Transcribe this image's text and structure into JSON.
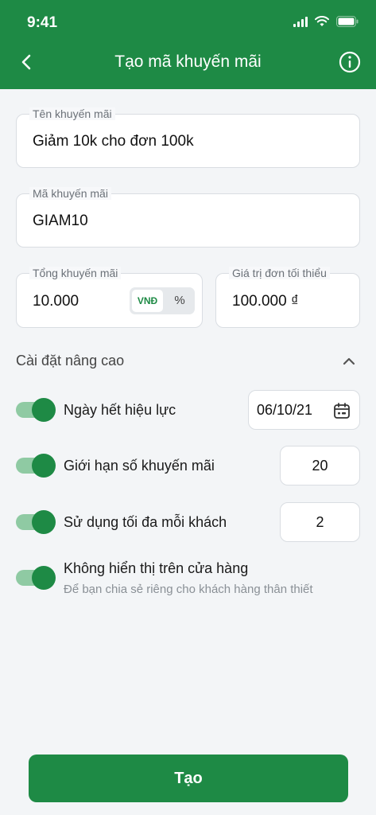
{
  "status": {
    "time": "9:41"
  },
  "header": {
    "title": "Tạo mã khuyến mãi"
  },
  "form": {
    "promo_name": {
      "label": "Tên khuyến mãi",
      "value": "Giảm 10k cho đơn 100k"
    },
    "promo_code": {
      "label": "Mã khuyến mãi",
      "value": "GIAM10"
    },
    "total_discount": {
      "label": "Tổng khuyến mãi",
      "value": "10.000",
      "unit_vnd": "VNĐ",
      "unit_percent": "%",
      "selected_unit": "VNĐ"
    },
    "min_order": {
      "label": "Giá trị đơn tối thiểu",
      "value": "100.000 ₫"
    }
  },
  "advanced": {
    "title": "Cài đặt nâng cao",
    "expiry": {
      "label": "Ngày hết hiệu lực",
      "value": "06/10/21",
      "enabled": true
    },
    "limit": {
      "label": "Giới hạn số khuyến mãi",
      "value": "20",
      "enabled": true
    },
    "per_customer": {
      "label": "Sử dụng tối đa mỗi khách",
      "value": "2",
      "enabled": true
    },
    "hidden": {
      "label": "Không hiển thị trên cửa hàng",
      "subtitle": "Để bạn chia sẻ riêng cho khách hàng thân thiết",
      "enabled": true
    }
  },
  "actions": {
    "create_label": "Tạo"
  },
  "colors": {
    "primary": "#1e8a45",
    "toggle_track": "#8fcaa3",
    "background": "#f3f5f7"
  }
}
